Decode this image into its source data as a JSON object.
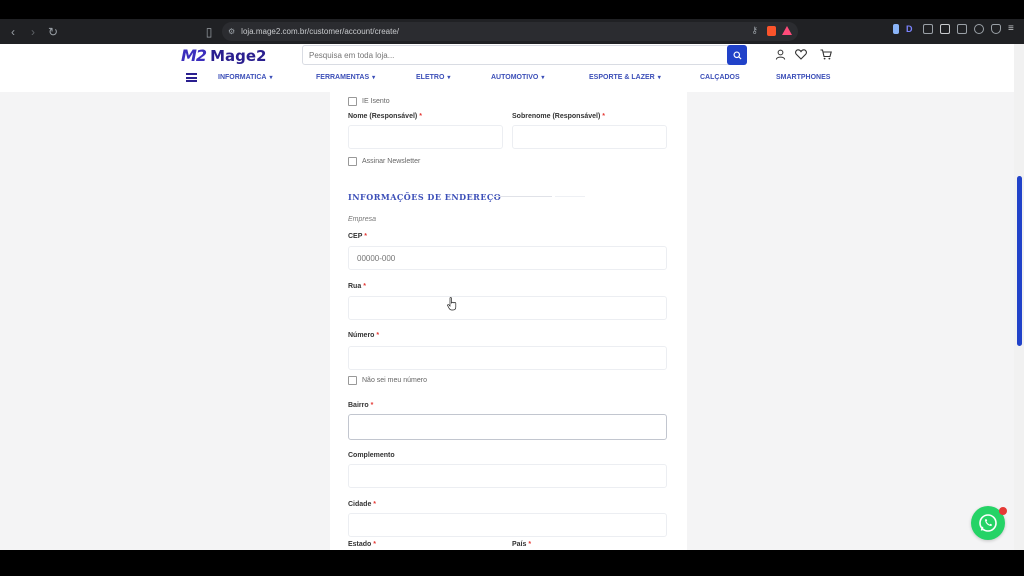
{
  "browser": {
    "url": "loja.mage2.com.br/customer/account/create/"
  },
  "header": {
    "logo_mark": "M2",
    "logo_text": "Mage2",
    "search_placeholder": "Pesquisa em toda loja..."
  },
  "menu": {
    "items": [
      {
        "label": "INFORMATICA",
        "dropdown": true
      },
      {
        "label": "FERRAMENTAS",
        "dropdown": true
      },
      {
        "label": "ELETRO",
        "dropdown": true
      },
      {
        "label": "AUTOMOTIVO",
        "dropdown": true
      },
      {
        "label": "ESPORTE & LAZER",
        "dropdown": true
      },
      {
        "label": "CALÇADOS",
        "dropdown": false
      },
      {
        "label": "SMARTPHONES",
        "dropdown": false
      }
    ]
  },
  "form": {
    "ie_isento": "IE Isento",
    "nome_label": "Nome (Responsável)",
    "sobrenome_label": "Sobrenome (Responsável)",
    "newsletter": "Assinar Newsletter",
    "address_title": "INFORMAÇÕES DE ENDEREÇO",
    "empresa": "Empresa",
    "cep_label": "CEP",
    "cep_placeholder": "00000-000",
    "rua_label": "Rua",
    "numero_label": "Número",
    "nao_sei_numero": "Não sei meu número",
    "bairro_label": "Bairro",
    "complemento_label": "Complemento",
    "cidade_label": "Cidade",
    "estado_label": "Estado",
    "pais_label": "País",
    "required_mark": "*"
  },
  "colors": {
    "accent": "#2142c9",
    "brand": "#2a1f8f",
    "menu": "#3c4fb8",
    "required": "#e53935",
    "whatsapp": "#25d366"
  }
}
